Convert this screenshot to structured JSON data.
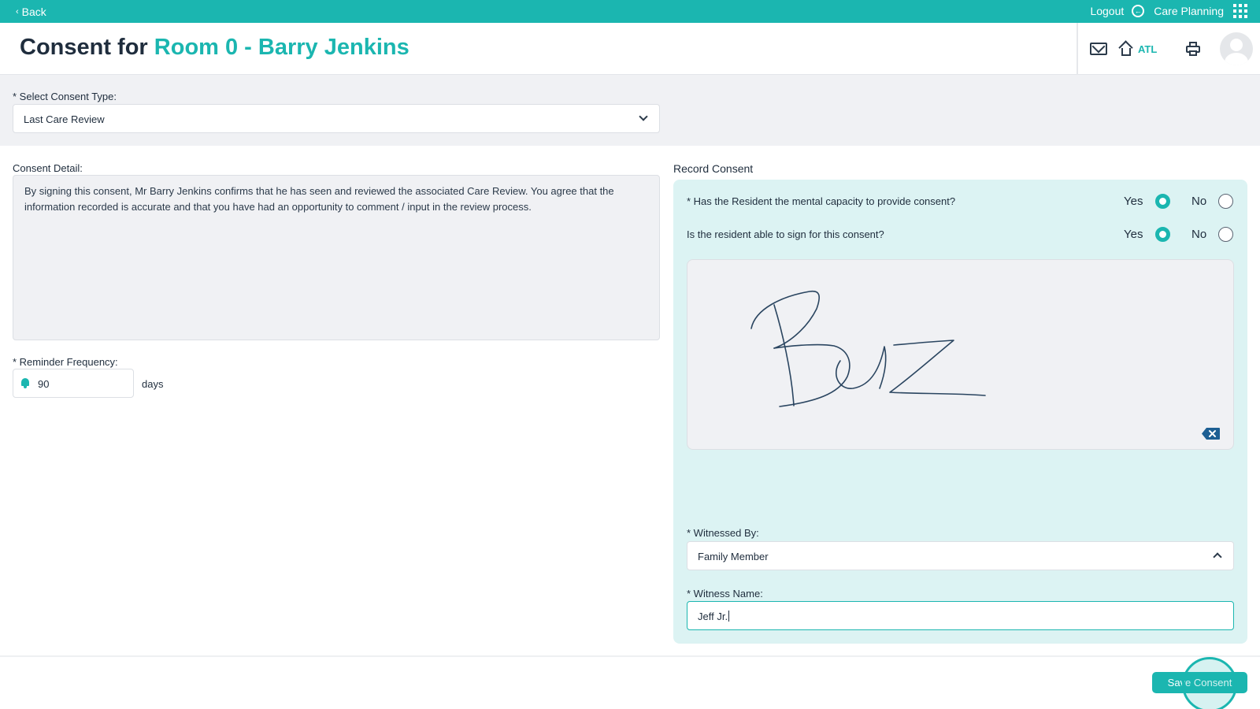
{
  "topbar": {
    "back_label": "Back",
    "logout_label": "Logout",
    "module_label": "Care Planning"
  },
  "header": {
    "title_prefix": "Consent for",
    "title_subject": "Room 0 - Barry Jenkins",
    "home_label": "ATL"
  },
  "consent_type": {
    "label": "* Select Consent Type:",
    "value": "Last Care Review"
  },
  "consent_detail": {
    "label": "Consent Detail:",
    "text": "By signing this consent, Mr Barry Jenkins confirms that he has seen and reviewed the associated Care Review.  You agree that the information recorded is accurate and that you have had an opportunity to comment / input in the review process."
  },
  "reminder": {
    "label": "* Reminder Frequency:",
    "value": "90",
    "unit": "days"
  },
  "record_consent": {
    "title": "Record Consent",
    "questions": [
      {
        "text": "* Has the Resident the mental capacity to provide consent?",
        "yes_label": "Yes",
        "no_label": "No",
        "selected": "Yes"
      },
      {
        "text": "Is the resident able to sign for this consent?",
        "yes_label": "Yes",
        "no_label": "No",
        "selected": "Yes"
      }
    ],
    "signature_text": "Boz",
    "witnessed_by": {
      "label": "* Witnessed By:",
      "value": "Family Member"
    },
    "witness_name": {
      "label": "* Witness Name:",
      "value": "Jeff Jr."
    }
  },
  "footer": {
    "save_label": "Save Consent"
  },
  "colors": {
    "accent": "#1bb6b0",
    "panel": "#dcf3f3",
    "section_bg": "#f0f1f4"
  }
}
